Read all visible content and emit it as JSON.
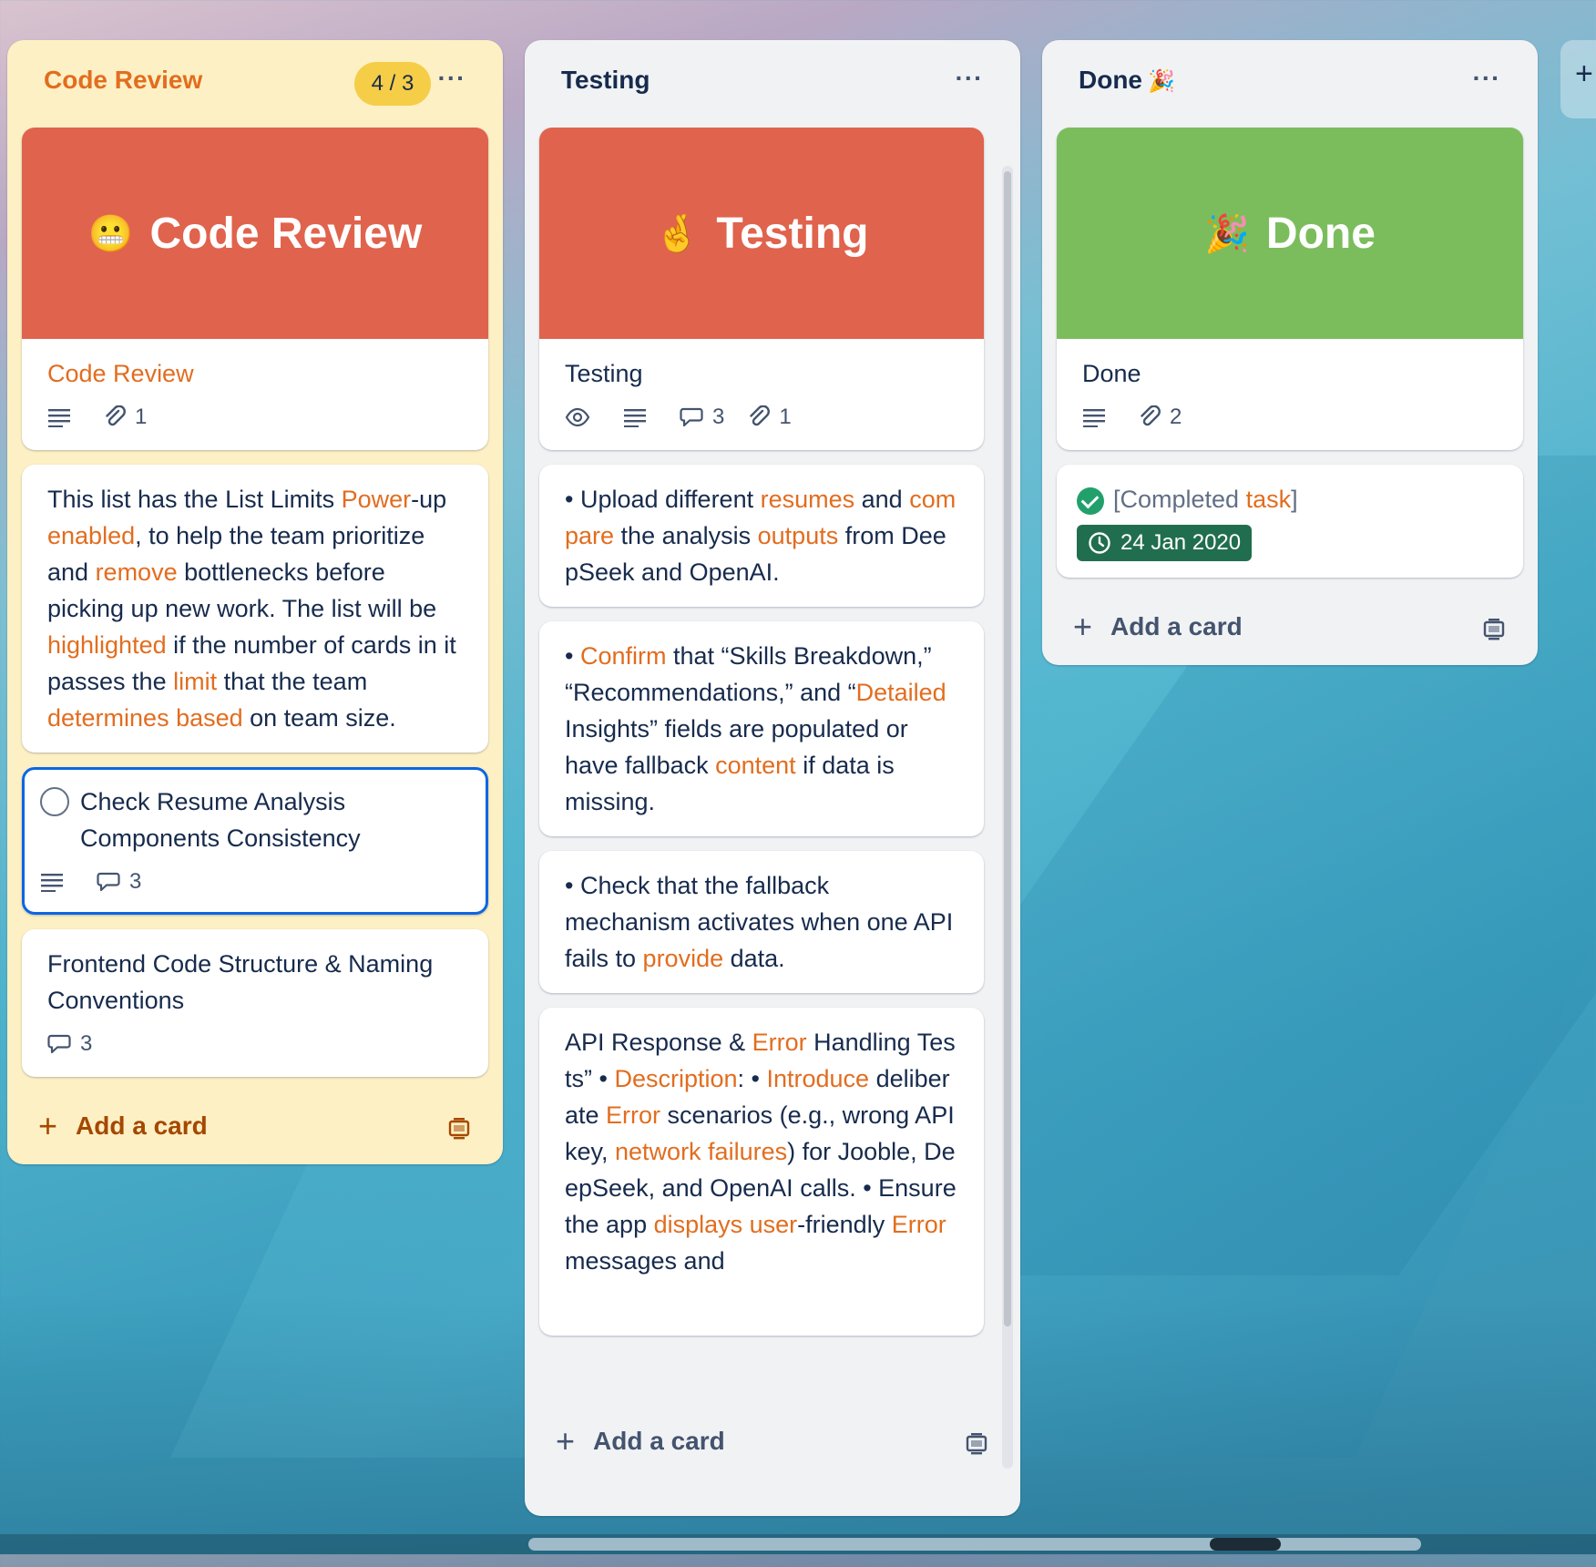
{
  "lists": {
    "code_review": {
      "title": "Code Review",
      "limit_badge": "4 / 3",
      "cover_title": "Code Review",
      "cover_emoji": "😬",
      "cover_color": "#e0634d",
      "card1_title": "Code Review",
      "card1_attachments": "1",
      "description_segments": [
        {
          "t": "This list has the List Limits ",
          "hl": false
        },
        {
          "t": "Power",
          "hl": true
        },
        {
          "t": "-up ",
          "hl": false
        },
        {
          "t": "enabled",
          "hl": true
        },
        {
          "t": ", to help the team prioritize and ",
          "hl": false
        },
        {
          "t": "remove",
          "hl": true
        },
        {
          "t": " bottlenecks before picking up new work. The list will be ",
          "hl": false
        },
        {
          "t": "highlighted",
          "hl": true
        },
        {
          "t": " if the number of cards in it passes the ",
          "hl": false
        },
        {
          "t": "limit",
          "hl": true
        },
        {
          "t": " that the team ",
          "hl": false
        },
        {
          "t": "determines based",
          "hl": true
        },
        {
          "t": " on team size.",
          "hl": false
        }
      ],
      "card3_title": "Check Resume Analysis Components Consistency",
      "card3_comments": "3",
      "card4_title": "Frontend Code Structure & Naming Conventions",
      "card4_comments": "3",
      "add_card": "Add a card"
    },
    "testing": {
      "title": "Testing",
      "cover_title": "Testing",
      "cover_emoji": "🤞",
      "cover_color": "#e0634d",
      "card1_title": "Testing",
      "card1_comments": "3",
      "card1_attachments": "1",
      "card2_segments": [
        {
          "t": "• Upload different ",
          "hl": false
        },
        {
          "t": "resumes",
          "hl": true
        },
        {
          "t": " and ",
          "hl": false
        },
        {
          "t": "compare",
          "hl": true
        },
        {
          "t": " the analysis ",
          "hl": false
        },
        {
          "t": "outputs",
          "hl": true
        },
        {
          "t": " from DeepSeek and OpenAI.",
          "hl": false
        }
      ],
      "card3_segments": [
        {
          "t": "• ",
          "hl": false
        },
        {
          "t": "Confirm",
          "hl": true
        },
        {
          "t": " that “Skills Breakdown,” “Recommendations,” and “",
          "hl": false
        },
        {
          "t": "Detailed",
          "hl": true
        },
        {
          "t": " Insights” fields are populated or have fallback ",
          "hl": false
        },
        {
          "t": "content",
          "hl": true
        },
        {
          "t": " if data is missing.",
          "hl": false
        }
      ],
      "card4_segments": [
        {
          "t": "• Check that the fallback mechanism activates when one API fails to ",
          "hl": false
        },
        {
          "t": "provide",
          "hl": true
        },
        {
          "t": " data.",
          "hl": false
        }
      ],
      "card5_segments": [
        {
          "t": "API Response & ",
          "hl": false
        },
        {
          "t": "Error",
          "hl": true
        },
        {
          "t": " Handling Tests” • ",
          "hl": false
        },
        {
          "t": "Description",
          "hl": true
        },
        {
          "t": ": • ",
          "hl": false
        },
        {
          "t": "Introduce",
          "hl": true
        },
        {
          "t": " deliberate ",
          "hl": false
        },
        {
          "t": "Error",
          "hl": true
        },
        {
          "t": " scenarios (e.g., wrong API key, ",
          "hl": false
        },
        {
          "t": "network failures",
          "hl": true
        },
        {
          "t": ") for Jooble, DeepSeek, and OpenAI calls. • Ensure the app ",
          "hl": false
        },
        {
          "t": "displays user",
          "hl": true
        },
        {
          "t": "-friendly ",
          "hl": false
        },
        {
          "t": "Error",
          "hl": true
        },
        {
          "t": " messages and",
          "hl": false
        }
      ],
      "add_card": "Add a card"
    },
    "done": {
      "title": "Done",
      "title_emoji": "🎉",
      "cover_title": "Done",
      "cover_emoji": "🎉",
      "cover_color": "#7bbd5c",
      "card1_title": "Done",
      "card1_attachments": "2",
      "card2_prefix": "[Completed ",
      "card2_highlight": "task",
      "card2_suffix": "]",
      "card2_date": "24 Jan 2020",
      "add_card": "Add a card"
    }
  },
  "add_list_icon": "+",
  "colors": {
    "highlight": "#e26d1f",
    "limit_list_bg": "#fdf0c4",
    "badge": "#f5cd47",
    "date_badge": "#216e4e",
    "selection": "#0c66e4"
  }
}
